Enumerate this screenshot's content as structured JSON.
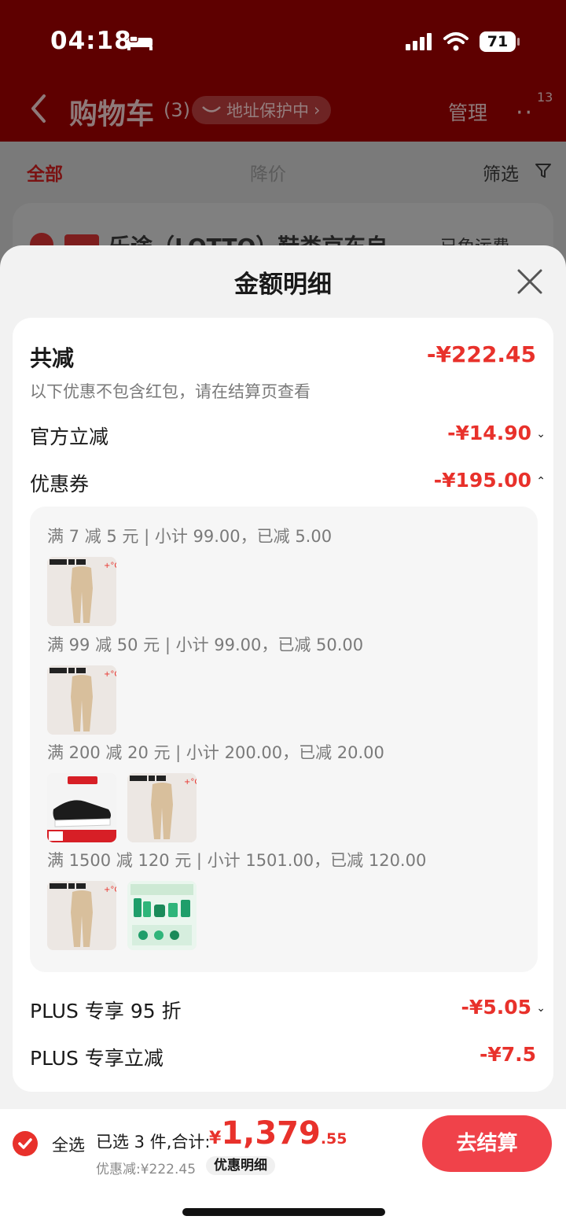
{
  "status_bar": {
    "time": "04:18",
    "battery": "71"
  },
  "nav": {
    "title": "购物车",
    "count": "(3)",
    "address_pill": "地址保护中",
    "manage": "管理",
    "more_badge": "13"
  },
  "filter_tabs": {
    "all": "全部",
    "price_drop": "降价",
    "filter": "筛选"
  },
  "background_shop": {
    "name": "乐途（LOTTO）鞋类京东自…",
    "shipping": "已免运费"
  },
  "sheet": {
    "title": "金额明细",
    "total_label": "共减",
    "total_value": "-¥222.45",
    "note": "以下优惠不包含红包，请在结算页查看",
    "official_label": "官方立减",
    "official_value": "-¥14.90",
    "coupon_label": "优惠券",
    "coupon_value": "-¥195.00",
    "coupons": [
      {
        "text": "满 7 减 5 元 | 小计 99.00，已减 5.00",
        "items": [
          "tights-product"
        ]
      },
      {
        "text": "满 99 减 50 元 | 小计 99.00，已减 50.00",
        "items": [
          "tights-product"
        ]
      },
      {
        "text": "满 200 减 20 元 | 小计 200.00，已减 20.00",
        "items": [
          "lotto-sneaker",
          "tights-product"
        ]
      },
      {
        "text": "满 1500 减 120 元 | 小计 1501.00，已减 120.00",
        "items": [
          "tights-product",
          "skincare-set"
        ]
      }
    ],
    "plus_discount_label": "PLUS 专享 95 折",
    "plus_discount_value": "-¥5.05",
    "plus_cut_label": "PLUS 专享立减",
    "plus_cut_value": "-¥7.5"
  },
  "bottom_bar": {
    "select_all": "全选",
    "summary": "已选 3 件,合计:",
    "price_symbol": "¥",
    "price_int": "1,379",
    "price_dec": ".55",
    "discount": "优惠减:¥222.45",
    "detail_button": "优惠明细",
    "checkout": "去结算"
  },
  "colors": {
    "accent": "#e8312b",
    "header_bg": "#5e0000",
    "checkout_bg": "#f0424a"
  }
}
